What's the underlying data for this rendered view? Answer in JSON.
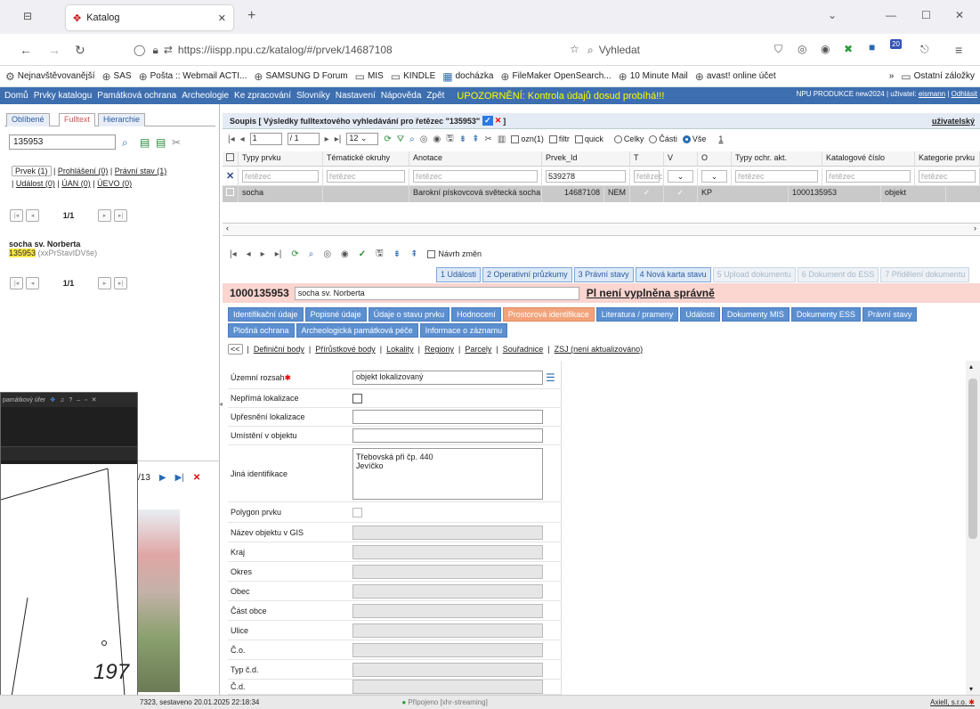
{
  "browser": {
    "tab_title": "Katalog",
    "url": "https://iispp.npu.cz/katalog/#/prvek/14687108",
    "url_host": "npu.cz",
    "search_placeholder": "Vyhledat",
    "bookmarks": [
      "Nejnavštěvovanější",
      "SAS",
      "Pošta :: Webmail ACTI...",
      "SAMSUNG D Forum",
      "MIS",
      "KINDLE",
      "docházka",
      "FileMaker OpenSearch...",
      "10 Minute Mail",
      "avast! online účet"
    ],
    "other_bookmarks": "Ostatní záložky",
    "badge_count": "20"
  },
  "menu": {
    "items": [
      "Domů",
      "Prvky katalogu",
      "Památková ochrana",
      "Archeologie",
      "Ke zpracování",
      "Slovníky",
      "Nastavení",
      "Nápověda",
      "Zpět"
    ],
    "warning": "UPOZORNĚNÍ: Kontrola údajů dosud probíhá!!!",
    "right_text": "NPU PRODUKCE new2024 | uživatel:",
    "user": "eismann",
    "logout": "Odhlásit"
  },
  "left": {
    "tabs": [
      "Oblíbené",
      "Fulltext",
      "Hierarchie"
    ],
    "search_value": "135953",
    "links": [
      "Prvek (1)",
      "Prohlášení (0)",
      "Právní stav (1)",
      "Událost (0)",
      "ÚAN (0)",
      "ÚEVO (0)"
    ],
    "pager": "1/1",
    "result_title": "socha sv. Norberta",
    "result_id": "135953",
    "result_sub": "(xxPrStavIDVše)",
    "pager2": "1/1"
  },
  "soupis": {
    "title": "Soupis  [ Výsledky fulltextového vyhledávání pro řetězec \"135953\"",
    "close": "]",
    "user_link": "uživatelský",
    "page_from": "1",
    "page_to": "/ 1",
    "per_page": "12",
    "ozn": "ozn(1)",
    "filtr": "filtr",
    "quick": "quick",
    "celky": "Celky",
    "casti": "Části",
    "vse": "Vše",
    "num": "1"
  },
  "grid": {
    "headers": [
      "Typy prvku",
      "Tématické okruhy",
      "Anotace",
      "Prvek_Id",
      "T",
      "V",
      "O",
      "Typy ochr. akt.",
      "Katalogové číslo",
      "Kategorie prvku"
    ],
    "filter_placeholder": "řetězec",
    "filter_prvek_id": "539278",
    "row": [
      "socha",
      "",
      "Barokní pískovcová světecká socha",
      "14687108",
      "NEM",
      "",
      "",
      "KP",
      "1000135953",
      "objekt"
    ]
  },
  "detail": {
    "navrh": "Návrh změn",
    "blue_tabs": [
      "1 Události",
      "2 Operativní průzkumy",
      "3 Právní stavy",
      "4 Nová karta stavu",
      "5 Upload dokumentu",
      "6 Dokument do ESS",
      "7 Přidělení dokumentu"
    ],
    "cat_number": "1000135953",
    "name_value": "socha sv. Norberta",
    "pl_warning": "Pl není vyplněna správně",
    "tabs_row1": [
      "Identifikační údaje",
      "Popisné údaje",
      "Údaje o stavu prvku",
      "Hodnocení",
      "Prostorová identifikace",
      "Literatura / prameny",
      "Události",
      "Dokumenty MIS",
      "Dokumenty ESS",
      "Právní stavy"
    ],
    "tabs_row2": [
      "Plošná ochrana",
      "Archeologická památková péče",
      "Informace o záznamu"
    ],
    "subnav_back": "<<",
    "subnav": [
      "Definiční body",
      "Přírůstkové body",
      "Lokality",
      "Regiony",
      "Parcely",
      "Souřadnice",
      "ZSJ (není aktualizováno)"
    ],
    "fields": {
      "uzemni_rozsah": {
        "label": "Územní rozsah",
        "value": "objekt lokalizovaný"
      },
      "neprima": "Nepřímá lokalizace",
      "upresneni": "Upřesnění lokalizace",
      "umisteni": "Umístění v objektu",
      "jina": {
        "label": "Jiná identifikace",
        "line1": "Třebovská při čp. 440",
        "line2": "Jevíčko"
      },
      "polygon": "Polygon prvku",
      "nazev_gis": "Název objektu v GIS",
      "kraj": "Kraj",
      "okres": "Okres",
      "obec": "Obec",
      "cast_obce": "Část obce",
      "ulice": "Ulice",
      "co": "Č.o.",
      "typ_cd": "Typ č.d.",
      "cd": "Č.d."
    }
  },
  "overlay": {
    "title": "památkový úřer",
    "counter": "/13",
    "map_number": "197"
  },
  "status": {
    "left": "7323, sestaveno 20.01.2025 22:18:34",
    "center": "Připojeno [xhr-streaming]",
    "right": "Axiell, s.r.o."
  }
}
